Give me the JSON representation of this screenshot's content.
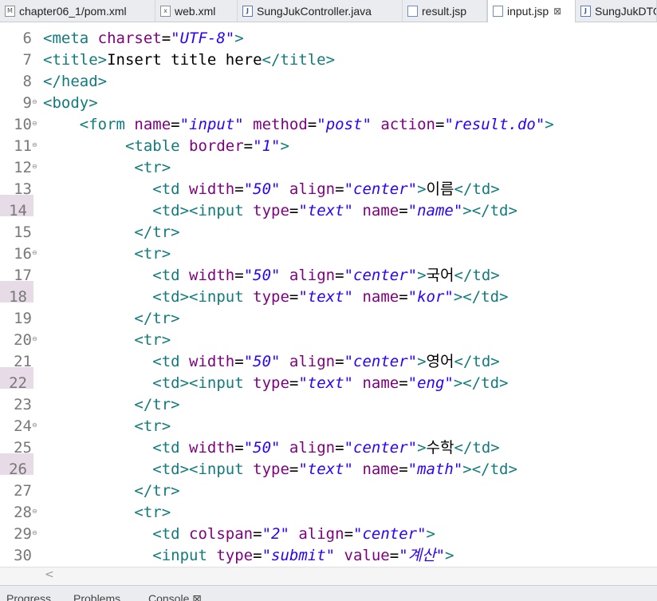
{
  "tabs": [
    {
      "label": "chapter06_1/pom.xml",
      "icon": "maven-file-icon",
      "icon_glyph": "M"
    },
    {
      "label": "web.xml",
      "icon": "xml-file-icon",
      "icon_glyph": "x"
    },
    {
      "label": "SungJukController.java",
      "icon": "java-file-icon",
      "icon_glyph": "J"
    },
    {
      "label": "result.jsp",
      "icon": "jsp-file-icon",
      "icon_glyph": ""
    },
    {
      "label": "input.jsp",
      "icon": "jsp-file-icon",
      "icon_glyph": "",
      "active": true,
      "close": "⊠"
    },
    {
      "label": "SungJukDTO",
      "icon": "java-file-icon",
      "icon_glyph": "J"
    }
  ],
  "editor": {
    "highlighted_lines": [
      "14",
      "18",
      "22",
      "26"
    ],
    "folding_lines": [
      "9",
      "10",
      "11",
      "12",
      "16",
      "20",
      "24",
      "28",
      "29"
    ],
    "lines": [
      {
        "n": "6",
        "tokens": [
          [
            "t",
            "<meta "
          ],
          [
            "a",
            "charset"
          ],
          [
            "txt",
            "="
          ],
          [
            "v",
            "\"UTF-8\""
          ],
          [
            "t",
            ">"
          ]
        ]
      },
      {
        "n": "7",
        "tokens": [
          [
            "t",
            "<title>"
          ],
          [
            "txt",
            "Insert title here"
          ],
          [
            "t",
            "</title>"
          ]
        ]
      },
      {
        "n": "8",
        "tokens": [
          [
            "t",
            "</head>"
          ]
        ]
      },
      {
        "n": "9",
        "tokens": [
          [
            "t",
            "<body>"
          ]
        ]
      },
      {
        "n": "10",
        "tokens": [
          [
            "txt",
            "    "
          ],
          [
            "t",
            "<form "
          ],
          [
            "a",
            "name"
          ],
          [
            "txt",
            "="
          ],
          [
            "v",
            "\"input\""
          ],
          [
            "txt",
            " "
          ],
          [
            "a",
            "method"
          ],
          [
            "txt",
            "="
          ],
          [
            "v",
            "\"post\""
          ],
          [
            "txt",
            " "
          ],
          [
            "a",
            "action"
          ],
          [
            "txt",
            "="
          ],
          [
            "v",
            "\"result.do\""
          ],
          [
            "t",
            ">"
          ]
        ]
      },
      {
        "n": "11",
        "tokens": [
          [
            "txt",
            "         "
          ],
          [
            "t",
            "<table "
          ],
          [
            "a",
            "border"
          ],
          [
            "txt",
            "="
          ],
          [
            "v",
            "\"1\""
          ],
          [
            "t",
            ">"
          ]
        ]
      },
      {
        "n": "12",
        "tokens": [
          [
            "txt",
            "          "
          ],
          [
            "t",
            "<tr>"
          ]
        ]
      },
      {
        "n": "13",
        "tokens": [
          [
            "txt",
            "            "
          ],
          [
            "t",
            "<td "
          ],
          [
            "a",
            "width"
          ],
          [
            "txt",
            "="
          ],
          [
            "v",
            "\"50\""
          ],
          [
            "txt",
            " "
          ],
          [
            "a",
            "align"
          ],
          [
            "txt",
            "="
          ],
          [
            "v",
            "\"center\""
          ],
          [
            "t",
            ">"
          ],
          [
            "txt",
            "이름"
          ],
          [
            "t",
            "</td>"
          ]
        ]
      },
      {
        "n": "14",
        "tokens": [
          [
            "txt",
            "            "
          ],
          [
            "t",
            "<td><input "
          ],
          [
            "a",
            "type"
          ],
          [
            "txt",
            "="
          ],
          [
            "v",
            "\"text\""
          ],
          [
            "txt",
            " "
          ],
          [
            "a",
            "name"
          ],
          [
            "txt",
            "="
          ],
          [
            "v",
            "\"name\""
          ],
          [
            "t",
            "></td>"
          ]
        ]
      },
      {
        "n": "15",
        "tokens": [
          [
            "txt",
            "          "
          ],
          [
            "t",
            "</tr>"
          ]
        ]
      },
      {
        "n": "16",
        "tokens": [
          [
            "txt",
            "          "
          ],
          [
            "t",
            "<tr>"
          ]
        ]
      },
      {
        "n": "17",
        "tokens": [
          [
            "txt",
            "            "
          ],
          [
            "t",
            "<td "
          ],
          [
            "a",
            "width"
          ],
          [
            "txt",
            "="
          ],
          [
            "v",
            "\"50\""
          ],
          [
            "txt",
            " "
          ],
          [
            "a",
            "align"
          ],
          [
            "txt",
            "="
          ],
          [
            "v",
            "\"center\""
          ],
          [
            "t",
            ">"
          ],
          [
            "txt",
            "국어"
          ],
          [
            "t",
            "</td>"
          ]
        ]
      },
      {
        "n": "18",
        "tokens": [
          [
            "txt",
            "            "
          ],
          [
            "t",
            "<td><input "
          ],
          [
            "a",
            "type"
          ],
          [
            "txt",
            "="
          ],
          [
            "v",
            "\"text\""
          ],
          [
            "txt",
            " "
          ],
          [
            "a",
            "name"
          ],
          [
            "txt",
            "="
          ],
          [
            "v",
            "\"kor\""
          ],
          [
            "t",
            "></td>"
          ]
        ]
      },
      {
        "n": "19",
        "tokens": [
          [
            "txt",
            "          "
          ],
          [
            "t",
            "</tr>"
          ]
        ]
      },
      {
        "n": "20",
        "tokens": [
          [
            "txt",
            "          "
          ],
          [
            "t",
            "<tr>"
          ]
        ]
      },
      {
        "n": "21",
        "tokens": [
          [
            "txt",
            "            "
          ],
          [
            "t",
            "<td "
          ],
          [
            "a",
            "width"
          ],
          [
            "txt",
            "="
          ],
          [
            "v",
            "\"50\""
          ],
          [
            "txt",
            " "
          ],
          [
            "a",
            "align"
          ],
          [
            "txt",
            "="
          ],
          [
            "v",
            "\"center\""
          ],
          [
            "t",
            ">"
          ],
          [
            "txt",
            "영어"
          ],
          [
            "t",
            "</td>"
          ]
        ]
      },
      {
        "n": "22",
        "tokens": [
          [
            "txt",
            "            "
          ],
          [
            "t",
            "<td><input "
          ],
          [
            "a",
            "type"
          ],
          [
            "txt",
            "="
          ],
          [
            "v",
            "\"text\""
          ],
          [
            "txt",
            " "
          ],
          [
            "a",
            "name"
          ],
          [
            "txt",
            "="
          ],
          [
            "v",
            "\"eng\""
          ],
          [
            "t",
            "></td>"
          ]
        ]
      },
      {
        "n": "23",
        "tokens": [
          [
            "txt",
            "          "
          ],
          [
            "t",
            "</tr>"
          ]
        ]
      },
      {
        "n": "24",
        "tokens": [
          [
            "txt",
            "          "
          ],
          [
            "t",
            "<tr>"
          ]
        ]
      },
      {
        "n": "25",
        "tokens": [
          [
            "txt",
            "            "
          ],
          [
            "t",
            "<td "
          ],
          [
            "a",
            "width"
          ],
          [
            "txt",
            "="
          ],
          [
            "v",
            "\"50\""
          ],
          [
            "txt",
            " "
          ],
          [
            "a",
            "align"
          ],
          [
            "txt",
            "="
          ],
          [
            "v",
            "\"center\""
          ],
          [
            "t",
            ">"
          ],
          [
            "txt",
            "수학"
          ],
          [
            "t",
            "</td>"
          ]
        ]
      },
      {
        "n": "26",
        "tokens": [
          [
            "txt",
            "            "
          ],
          [
            "t",
            "<td><input "
          ],
          [
            "a",
            "type"
          ],
          [
            "txt",
            "="
          ],
          [
            "v",
            "\"text\""
          ],
          [
            "txt",
            " "
          ],
          [
            "a",
            "name"
          ],
          [
            "txt",
            "="
          ],
          [
            "v",
            "\"math\""
          ],
          [
            "t",
            "></td>"
          ]
        ]
      },
      {
        "n": "27",
        "tokens": [
          [
            "txt",
            "          "
          ],
          [
            "t",
            "</tr>"
          ]
        ]
      },
      {
        "n": "28",
        "tokens": [
          [
            "txt",
            "          "
          ],
          [
            "t",
            "<tr>"
          ]
        ]
      },
      {
        "n": "29",
        "tokens": [
          [
            "txt",
            "            "
          ],
          [
            "t",
            "<td "
          ],
          [
            "a",
            "colspan"
          ],
          [
            "txt",
            "="
          ],
          [
            "v",
            "\"2\""
          ],
          [
            "txt",
            " "
          ],
          [
            "a",
            "align"
          ],
          [
            "txt",
            "="
          ],
          [
            "v",
            "\"center\""
          ],
          [
            "t",
            ">"
          ]
        ]
      },
      {
        "n": "30",
        "tokens": [
          [
            "txt",
            "            "
          ],
          [
            "t",
            "<input "
          ],
          [
            "a",
            "type"
          ],
          [
            "txt",
            "="
          ],
          [
            "v",
            "\"submit\""
          ],
          [
            "txt",
            " "
          ],
          [
            "a",
            "value"
          ],
          [
            "txt",
            "="
          ],
          [
            "v",
            "\"계산\""
          ],
          [
            "t",
            ">"
          ]
        ]
      }
    ]
  },
  "scrollbar": {
    "left_arrow": "<"
  },
  "bottom_tabs": [
    "Progress",
    "Problems",
    "Console ⊠"
  ],
  "colors": {
    "tag": "#117b7b",
    "attribute": "#7f007f",
    "value": "#2a00ff",
    "gutter_highlight": "#e8dbe8"
  }
}
